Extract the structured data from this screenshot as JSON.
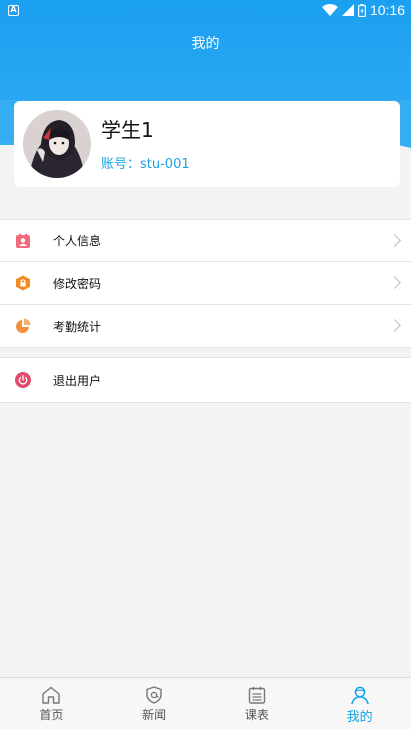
{
  "status_bar": {
    "time": "10:16",
    "icons": [
      "notification-a-icon",
      "wifi-icon",
      "signal-icon",
      "battery-icon"
    ]
  },
  "header": {
    "title": "我的",
    "accent_color": "#1ba0f0"
  },
  "profile": {
    "name": "学生1",
    "account": "账号：stu-001",
    "account_color": "#1aa3e3"
  },
  "menu": {
    "items": [
      {
        "label": "个人信息",
        "icon": "id-card-icon",
        "color": "#f06a7a"
      },
      {
        "label": "修改密码",
        "icon": "lock-shield-icon",
        "color": "#f58a1f"
      },
      {
        "label": "考勤统计",
        "icon": "pie-chart-icon",
        "color": "#f5903c"
      }
    ],
    "logout": {
      "label": "退出用户",
      "icon": "power-icon",
      "color": "#e14b6d"
    }
  },
  "tabs": [
    {
      "label": "首页",
      "icon": "home-icon"
    },
    {
      "label": "新闻",
      "icon": "news-icon"
    },
    {
      "label": "课表",
      "icon": "calendar-icon"
    },
    {
      "label": "我的",
      "icon": "user-icon",
      "active": true
    }
  ]
}
